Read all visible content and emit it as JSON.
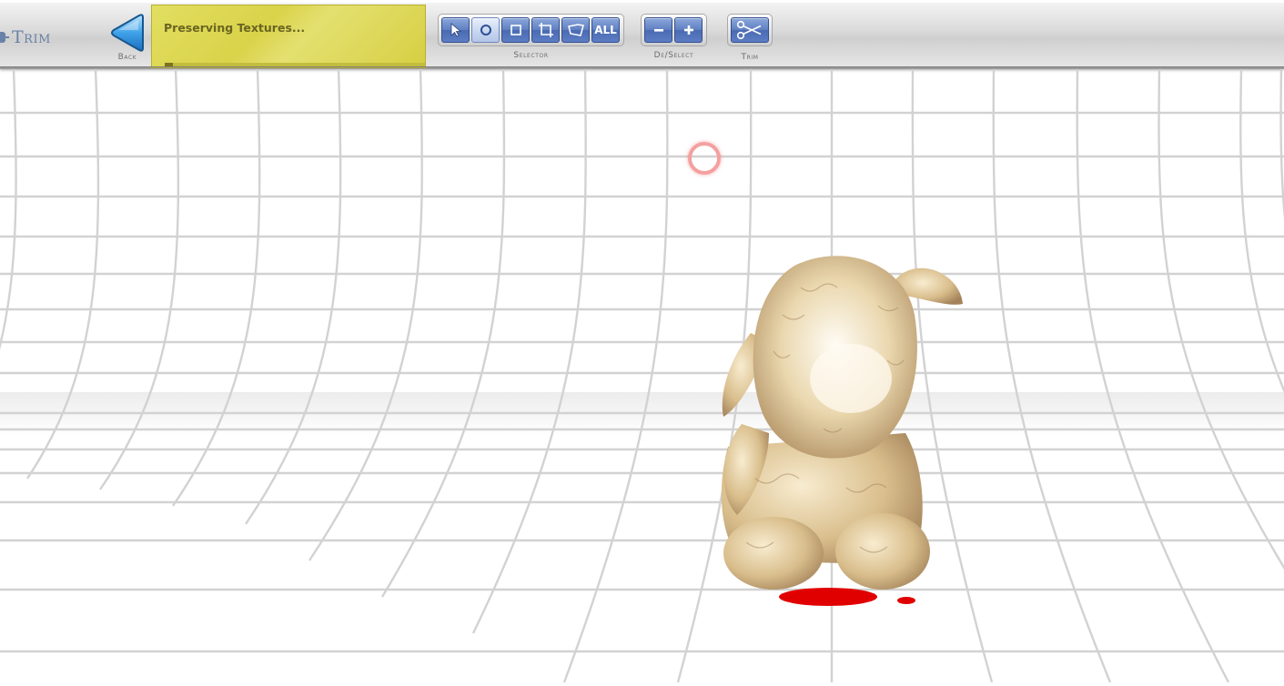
{
  "mode": {
    "title": "Trim",
    "icon": "gear-icon"
  },
  "back": {
    "label": "Back",
    "icon": "back-arrow-icon"
  },
  "status": {
    "text": "Preserving Textures...",
    "progress": 0.03
  },
  "selector": {
    "label": "Selector",
    "tools": [
      {
        "name": "arrow",
        "icon": "pointer-arrow-icon",
        "active": false
      },
      {
        "name": "circle",
        "icon": "circle-select-icon",
        "active": true
      },
      {
        "name": "rectangle",
        "icon": "rectangle-select-icon",
        "active": false
      },
      {
        "name": "crop",
        "icon": "crop-select-icon",
        "active": false
      },
      {
        "name": "lasso",
        "icon": "polygon-select-icon",
        "active": false
      },
      {
        "name": "all",
        "label": "ALL",
        "active": false
      }
    ]
  },
  "deselect": {
    "label": "De/Select",
    "minus_icon": "minus-icon",
    "plus_icon": "plus-icon"
  },
  "trim": {
    "label": "Trim",
    "icon": "scissors-icon"
  },
  "colors": {
    "accent_blue": "#5c7cc4",
    "status_yellow": "#dcd650",
    "grid_line": "#cfcfcf",
    "cursor_ring": "#f4a0a0",
    "base_red": "#e00000"
  }
}
